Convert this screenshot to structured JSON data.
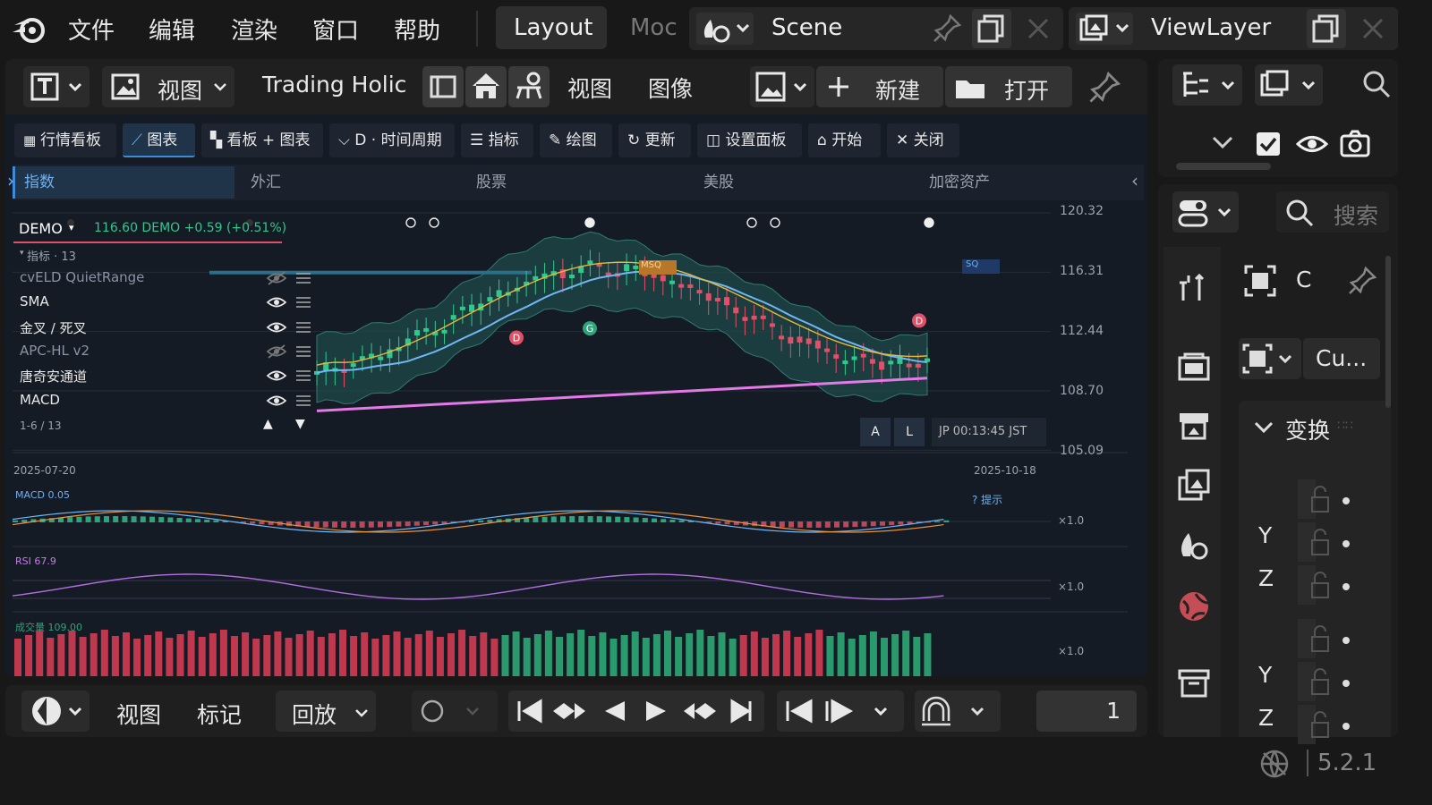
{
  "menu": {
    "items": [
      "文件",
      "编辑",
      "渲染",
      "窗口",
      "帮助"
    ]
  },
  "workspace": {
    "active": "Layout",
    "next": "Moc"
  },
  "scene": {
    "name": "Scene"
  },
  "viewlayer": {
    "name": "ViewLayer"
  },
  "editor_header": {
    "view": "视图",
    "title": "Trading Holic",
    "view2": "视图",
    "image": "图像",
    "new": "新建",
    "open": "打开"
  },
  "toolbar": {
    "buttons": [
      "行情看板",
      "图表",
      "看板 + 图表",
      "D · 时间周期",
      "指标",
      "绘图",
      "更新",
      "设置面板",
      "开始",
      "关闭"
    ]
  },
  "categories": [
    "指数",
    "外汇",
    "股票",
    "美股",
    "加密资产"
  ],
  "chart_header": {
    "symbol": "DEMO",
    "quote": "116.60 DEMO +0.59 (+0.51%)",
    "ind_count": "指标 · 13",
    "page": "1-6 / 13"
  },
  "indicators": [
    {
      "name": "cvELD QuietRange",
      "visible": false
    },
    {
      "name": "SMA",
      "visible": true
    },
    {
      "name": "金叉 / 死叉",
      "visible": true
    },
    {
      "name": "APC-HL v2",
      "visible": false
    },
    {
      "name": "唐奇安通道",
      "visible": true
    },
    {
      "name": "MACD",
      "visible": true
    }
  ],
  "chart_data": {
    "type": "line",
    "ylim": [
      105.09,
      120.32
    ],
    "y_ticks": [
      "120.32",
      "116.31",
      "112.44",
      "108.70",
      "105.09"
    ],
    "x_start": "2025-07-20",
    "x_end": "2025-10-18",
    "last_price": 116.6,
    "markers": [
      {
        "label": "D"
      },
      {
        "label": "G"
      },
      {
        "label": "D"
      }
    ],
    "labels": [
      "MSQ",
      "SQ"
    ],
    "timestamp": "JP 00:13:45 JST",
    "scale_buttons": [
      "A",
      "L"
    ],
    "sub_panels": [
      {
        "name": "MACD 0.05",
        "scale": "×1.0"
      },
      {
        "name": "RSI 67.9",
        "scale": "×1.0"
      },
      {
        "name": "成交量 109.00",
        "scale": "×1.0"
      }
    ],
    "hint": "? 提示"
  },
  "properties": {
    "search": "搜索",
    "obj": "C",
    "cam": "Cu...",
    "transform": "变换",
    "y": "Y",
    "z": "Z"
  },
  "timeline": {
    "view": "视图",
    "marker": "标记",
    "playback": "回放",
    "frame": "1"
  },
  "status": {
    "version": "5.2.1"
  },
  "colors": {
    "accent": "#3d8bd9",
    "bull": "#2fa37a",
    "bear": "#e05068",
    "band": "#1f4a4a"
  }
}
